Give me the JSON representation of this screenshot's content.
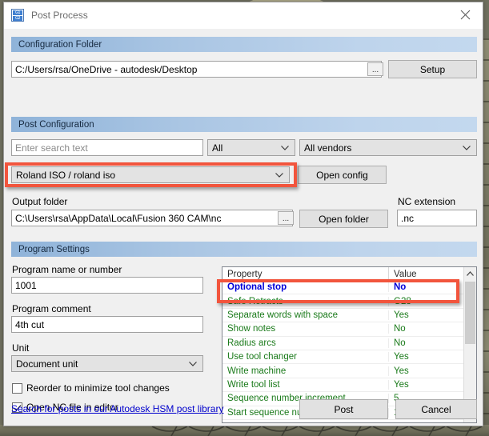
{
  "window": {
    "title": "Post Process",
    "icon": "gcode-icon",
    "icon_lines": [
      "G1",
      "G2"
    ],
    "close_icon": "close-icon"
  },
  "configuration_folder": {
    "header": "Configuration Folder",
    "path_value": "C:/Users/rsa/OneDrive - autodesk/Desktop",
    "browse_label": "...",
    "setup_label": "Setup"
  },
  "post_configuration": {
    "header": "Post Configuration",
    "search_placeholder": "Enter search text",
    "search_value": "",
    "category_value": "All",
    "vendor_value": "All vendors",
    "post_value": "Roland ISO / roland iso",
    "open_config_label": "Open config"
  },
  "output": {
    "folder_label": "Output folder",
    "folder_value": "C:\\Users\\rsa\\AppData\\Local\\Fusion 360 CAM\\nc",
    "browse_label": "...",
    "open_folder_label": "Open folder",
    "nc_extension_label": "NC extension",
    "nc_extension_value": ".nc"
  },
  "program_settings": {
    "header": "Program Settings",
    "name_label": "Program name or number",
    "name_value": "1001",
    "comment_label": "Program comment",
    "comment_value": "4th cut",
    "unit_label": "Unit",
    "unit_value": "Document unit",
    "reorder_label": "Reorder to minimize tool changes",
    "reorder_checked": false,
    "open_nc_label": "Open NC file in editor",
    "open_nc_checked": true
  },
  "property_grid": {
    "columns": [
      "Property",
      "Value"
    ],
    "rows": [
      {
        "property": "Optional stop",
        "value": "No",
        "selected": true
      },
      {
        "property": "Safe Retracts",
        "value": "G28",
        "selected": false
      },
      {
        "property": "Separate words with space",
        "value": "Yes",
        "selected": false
      },
      {
        "property": "Show notes",
        "value": "No",
        "selected": false
      },
      {
        "property": "Radius arcs",
        "value": "No",
        "selected": false
      },
      {
        "property": "Use tool changer",
        "value": "Yes",
        "selected": false
      },
      {
        "property": "Write machine",
        "value": "Yes",
        "selected": false
      },
      {
        "property": "Write tool list",
        "value": "Yes",
        "selected": false
      },
      {
        "property": "Sequence number increment",
        "value": "5",
        "selected": false
      },
      {
        "property": "Start sequence number",
        "value": "10",
        "selected": false
      }
    ]
  },
  "footer": {
    "link_label": "Search for posts in our Autodesk HSM post library",
    "post_label": "Post",
    "cancel_label": "Cancel"
  },
  "annotations": {
    "highlight_color": "#f2553d",
    "boxes": [
      "post-config-combo",
      "optional-stop-row"
    ]
  }
}
